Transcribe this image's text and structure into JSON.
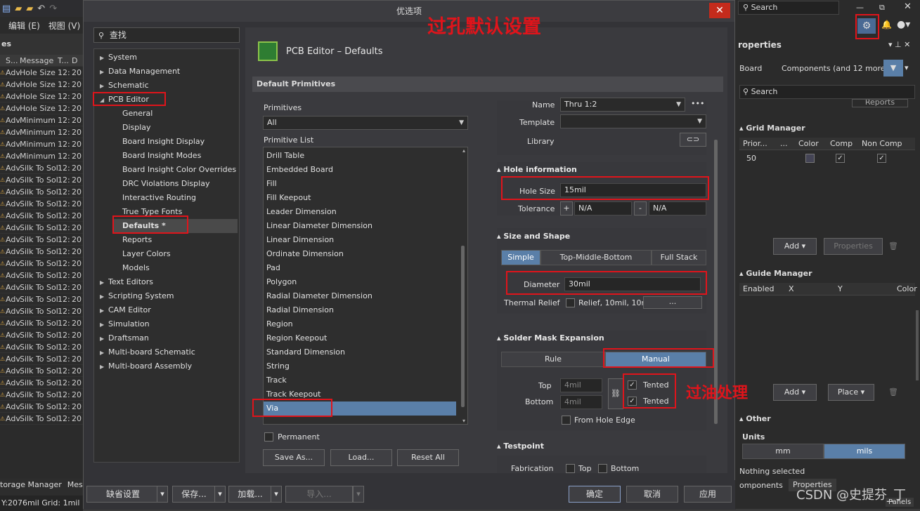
{
  "left_app": {
    "menu": [
      "编辑 (E)",
      "视图 (V)"
    ],
    "panel_title": "es",
    "columns": [
      "S...",
      "Message",
      "T...",
      "D"
    ],
    "rows": [
      [
        "Adv",
        "Hole Size (",
        "12:",
        "20"
      ],
      [
        "Adv",
        "Hole Size (",
        "12:",
        "20"
      ],
      [
        "Adv",
        "Hole Size (",
        "12:",
        "20"
      ],
      [
        "Adv",
        "Hole Size (",
        "12:",
        "20"
      ],
      [
        "Adv",
        "Minimum",
        "12:",
        "20"
      ],
      [
        "Adv",
        "Minimum",
        "12:",
        "20"
      ],
      [
        "Adv",
        "Minimum",
        "12:",
        "20"
      ],
      [
        "Adv",
        "Minimum",
        "12:",
        "20"
      ],
      [
        "Adv",
        "Silk To Sol",
        "12:",
        "20"
      ],
      [
        "Adv",
        "Silk To Sol",
        "12:",
        "20"
      ],
      [
        "Adv",
        "Silk To Sol",
        "12:",
        "20"
      ],
      [
        "Adv",
        "Silk To Sol",
        "12:",
        "20"
      ],
      [
        "Adv",
        "Silk To Sol",
        "12:",
        "20"
      ],
      [
        "Adv",
        "Silk To Sol",
        "12:",
        "20"
      ],
      [
        "Adv",
        "Silk To Sol",
        "12:",
        "20"
      ],
      [
        "Adv",
        "Silk To Sol",
        "12:",
        "20"
      ],
      [
        "Adv",
        "Silk To Sol",
        "12:",
        "20"
      ],
      [
        "Adv",
        "Silk To Sol",
        "12:",
        "20"
      ],
      [
        "Adv",
        "Silk To Sol",
        "12:",
        "20"
      ],
      [
        "Adv",
        "Silk To Sol",
        "12:",
        "20"
      ],
      [
        "Adv",
        "Silk To Sol",
        "12:",
        "20"
      ],
      [
        "Adv",
        "Silk To Sol",
        "12:",
        "20"
      ],
      [
        "Adv",
        "Silk To Sol",
        "12:",
        "20"
      ],
      [
        "Adv",
        "Silk To Sol",
        "12:",
        "20"
      ],
      [
        "Adv",
        "Silk To Sol",
        "12:",
        "20"
      ],
      [
        "Adv",
        "Silk To Sol",
        "12:",
        "20"
      ],
      [
        "Adv",
        "Silk To Sol",
        "12:",
        "20"
      ],
      [
        "Adv",
        "Silk To Sol",
        "12:",
        "20"
      ],
      [
        "Adv",
        "Silk To Sol",
        "12:",
        "20"
      ],
      [
        "Adv",
        "Silk To Sol",
        "12:",
        "20"
      ]
    ],
    "bottom_tabs": [
      "torage Manager",
      "Mes"
    ],
    "status": "Y:2076mil   Grid: 1mil"
  },
  "dialog": {
    "title": "优选项",
    "close": "✕",
    "search": "查找",
    "tree": [
      {
        "label": "System",
        "level": 0
      },
      {
        "label": "Data Management",
        "level": 0
      },
      {
        "label": "Schematic",
        "level": 0
      },
      {
        "label": "PCB Editor",
        "level": 0,
        "open": true
      },
      {
        "label": "General",
        "level": 1
      },
      {
        "label": "Display",
        "level": 1
      },
      {
        "label": "Board Insight Display",
        "level": 1
      },
      {
        "label": "Board Insight Modes",
        "level": 1
      },
      {
        "label": "Board Insight Color Overrides",
        "level": 1
      },
      {
        "label": "DRC Violations Display",
        "level": 1
      },
      {
        "label": "Interactive Routing",
        "level": 1
      },
      {
        "label": "True Type Fonts",
        "level": 1
      },
      {
        "label": "Defaults *",
        "level": 1,
        "selected": true
      },
      {
        "label": "Reports",
        "level": 1
      },
      {
        "label": "Layer Colors",
        "level": 1
      },
      {
        "label": "Models",
        "level": 1
      },
      {
        "label": "Text Editors",
        "level": 0
      },
      {
        "label": "Scripting System",
        "level": 0
      },
      {
        "label": "CAM Editor",
        "level": 0
      },
      {
        "label": "Simulation",
        "level": 0
      },
      {
        "label": "Draftsman",
        "level": 0
      },
      {
        "label": "Multi-board Schematic",
        "level": 0
      },
      {
        "label": "Multi-board Assembly",
        "level": 0
      }
    ],
    "page_title": "PCB Editor – Defaults",
    "default_primitives": "Default Primitives",
    "primitives_label": "Primitives",
    "primitives_value": "All",
    "primitive_list_label": "Primitive List",
    "primitive_list": [
      "Drill Table",
      "Embedded Board",
      "Fill",
      "Fill Keepout",
      "Leader Dimension",
      "Linear Diameter Dimension",
      "Linear Dimension",
      "Ordinate Dimension",
      "Pad",
      "Polygon",
      "Radial Diameter Dimension",
      "Radial Dimension",
      "Region",
      "Region Keepout",
      "Standard Dimension",
      "String",
      "Track",
      "Track Keepout",
      "Via"
    ],
    "permanent": "Permanent",
    "save_as": "Save As...",
    "load": "Load...",
    "reset_all": "Reset All",
    "props": {
      "name_label": "Name",
      "name_value": "Thru 1:2",
      "name_more": "•••",
      "template_label": "Template",
      "library_label": "Library",
      "hole_info": "Hole information",
      "hole_size_label": "Hole Size",
      "hole_size_value": "15mil",
      "tolerance_label": "Tolerance",
      "tol_plus": "+",
      "tol_plus_value": "N/A",
      "tol_minus": "-",
      "tol_minus_value": "N/A",
      "size_shape": "Size and Shape",
      "shape_tabs": [
        "Simple",
        "Top-Middle-Bottom",
        "Full Stack"
      ],
      "diameter_label": "Diameter",
      "diameter_value": "30mil",
      "thermal_label": "Thermal Relief",
      "thermal_value": "Relief, 10mil, 10m",
      "thermal_more": "...",
      "solder_mask": "Solder Mask Expansion",
      "mask_tabs": [
        "Rule",
        "Manual"
      ],
      "top_label": "Top",
      "top_value": "4mil",
      "bottom_label": "Bottom",
      "bottom_value": "4mil",
      "tented": "Tented",
      "tented2": "Tented",
      "from_hole_edge": "From Hole Edge",
      "testpoint": "Testpoint",
      "fabrication": "Fabrication",
      "tp_top": "Top",
      "tp_bottom": "Bottom"
    },
    "footer": {
      "default_settings": "缺省设置",
      "save": "保存...",
      "load": "加载...",
      "import": "导入...",
      "ok": "确定",
      "cancel": "取消",
      "apply": "应用"
    }
  },
  "right_app": {
    "search": "Search",
    "panel_title": "roperties",
    "board": "Board",
    "components": "Components (and 12 more)",
    "search2": "Search",
    "reports": "Reports",
    "grid_manager": "Grid Manager",
    "grid_cols": [
      "Prior...",
      "...",
      "Color",
      "Comp",
      "Non Comp"
    ],
    "grid_row": "50",
    "add": "Add",
    "properties_btn": "Properties",
    "guide_manager": "Guide Manager",
    "guide_cols": [
      "Enabled",
      "X",
      "Y",
      "Color"
    ],
    "add2": "Add",
    "place": "Place",
    "other": "Other",
    "units": "Units",
    "mm": "mm",
    "mils": "mils",
    "nothing_selected": "Nothing selected",
    "tab_components": "omponents",
    "tab_properties": "Properties",
    "panels": "Panels"
  },
  "annotations": {
    "via_defaults": "过孔默认设置",
    "tenting": "过油处理",
    "watermark": "CSDN @史提芬_丁"
  },
  "colors": {
    "highlight": "#e0141b",
    "selection": "#5a7fa8"
  }
}
